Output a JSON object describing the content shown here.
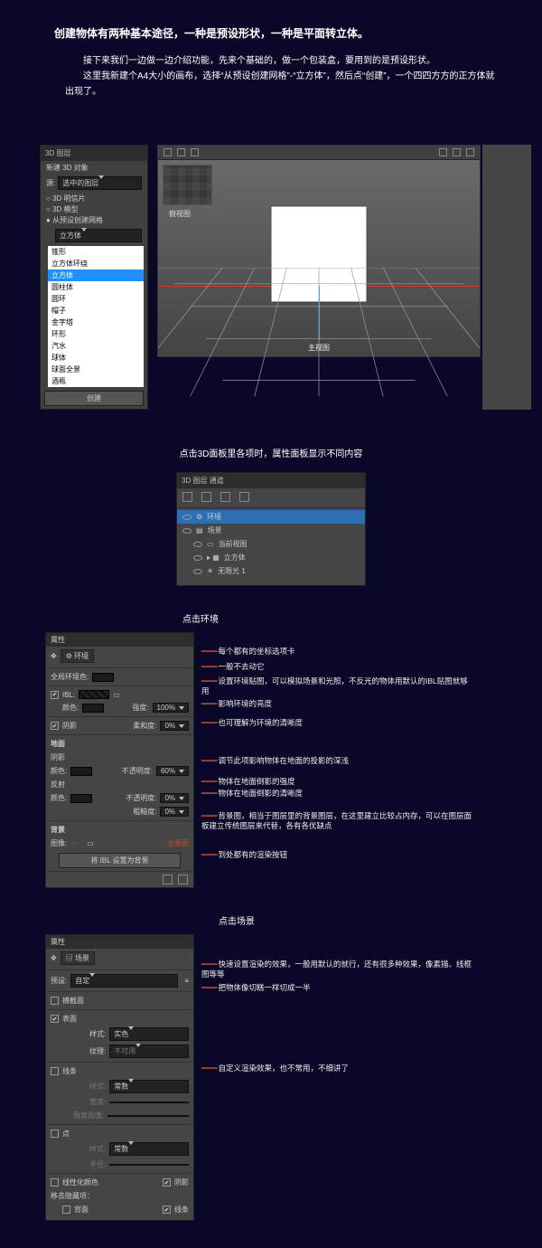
{
  "heading": "创建物体有两种基本途径，一种是预设形状，一种是平面转立体。",
  "intro": "　　接下来我们一边做一边介绍功能，先来个基础的，做一个包装盒，要用到的是预设形状。\n　　这里我新建个A4大小的画布，选择“从预设创建网格”-“立方体”，然后点“创建”，一个四四方方的正方体就出现了。",
  "panel_3d_create": {
    "tab": "3D  图层",
    "row1": "新建 3D 对象",
    "source_label": "源:",
    "source_value": "选中的图层",
    "opts": [
      "3D 明信片",
      "3D 模型",
      "从预设创建网格"
    ],
    "preset_selected": "立方体",
    "list": [
      "锥形",
      "立方体环绕",
      "立方体",
      "圆柱体",
      "圆环",
      "帽子",
      "金字塔",
      "环形",
      "汽水",
      "球体",
      "球面全景",
      "酒瓶"
    ],
    "create_btn": "创建"
  },
  "viewport": {
    "tile_label": "俯视图",
    "main_label": "主视图"
  },
  "caption1": "点击3D面板里各项时，属性面板显示不同内容",
  "items_panel": {
    "tab": "3D   图层   通道",
    "rows": [
      "环境",
      "场景",
      "当前视图",
      "立方体",
      "无限光 1"
    ]
  },
  "caption_env": "点击环境",
  "env_panel": {
    "tab": "属性",
    "crumb": "环境",
    "global_color": "全局环境色:",
    "ibl": "IBL:",
    "color": "颜色:",
    "intensity": "强度:",
    "intensity_v": "100%",
    "shadow": "阴影",
    "soft": "柔和度:",
    "soft_v": "0%",
    "ground": "地面",
    "g_shadow": "阴影",
    "g_color": "颜色:",
    "opacity": "不透明度:",
    "opacity_v": "60%",
    "reflect": "反射",
    "r_color": "颜色:",
    "r_opacity_v": "0%",
    "rough": "粗糙度:",
    "rough_v": "0%",
    "bg": "背景",
    "img": "图像:",
    "panorama": "全景图",
    "wbtn": "将 IBL 设置为背景"
  },
  "env_callouts": [
    "每个都有的坐标选项卡",
    "一般不去动它",
    "设置环境贴图，可以模拟场景和光照，不反光的物体用默认的IBL贴图就够用",
    "影响环境的亮度",
    "也可理解为环境的清晰度",
    "调节此项影响物体在地面的投影的深浅",
    "物体在地面倒影的强度",
    "物体在地面倒影的清晰度",
    "背景图，相当于图层里的背景图层，在这里建立比较占内存，可以在图层面板建立传统图层来代替，各有各优缺点",
    "到处都有的渲染按钮"
  ],
  "caption_scene": "点击场景",
  "scene_panel": {
    "tab": "属性",
    "crumb": "场景",
    "preset": "预设:",
    "preset_v": "自定",
    "cross": "横截面",
    "surface": "表面",
    "style": "样式:",
    "style_v": "实色",
    "texture": "纹理:",
    "texture_v": "不可用",
    "lines": "线条",
    "l_style_v": "常数",
    "width": "宽度:",
    "angle": "角度阈值:",
    "points": "点",
    "p_style_v": "常数",
    "radius": "半径:",
    "linear": "线性化颜色",
    "shadow2": "阴影",
    "remove": "移去隐藏项：",
    "bg2": "背面",
    "lines2": "线条"
  },
  "scene_callouts": [
    "快速设置渲染的效果，一般用默认的就行，还有很多种效果，像素描、线框图等等",
    "把物体像切糕一样切成一半",
    "自定义渲染效果，也不常用，不细讲了"
  ]
}
